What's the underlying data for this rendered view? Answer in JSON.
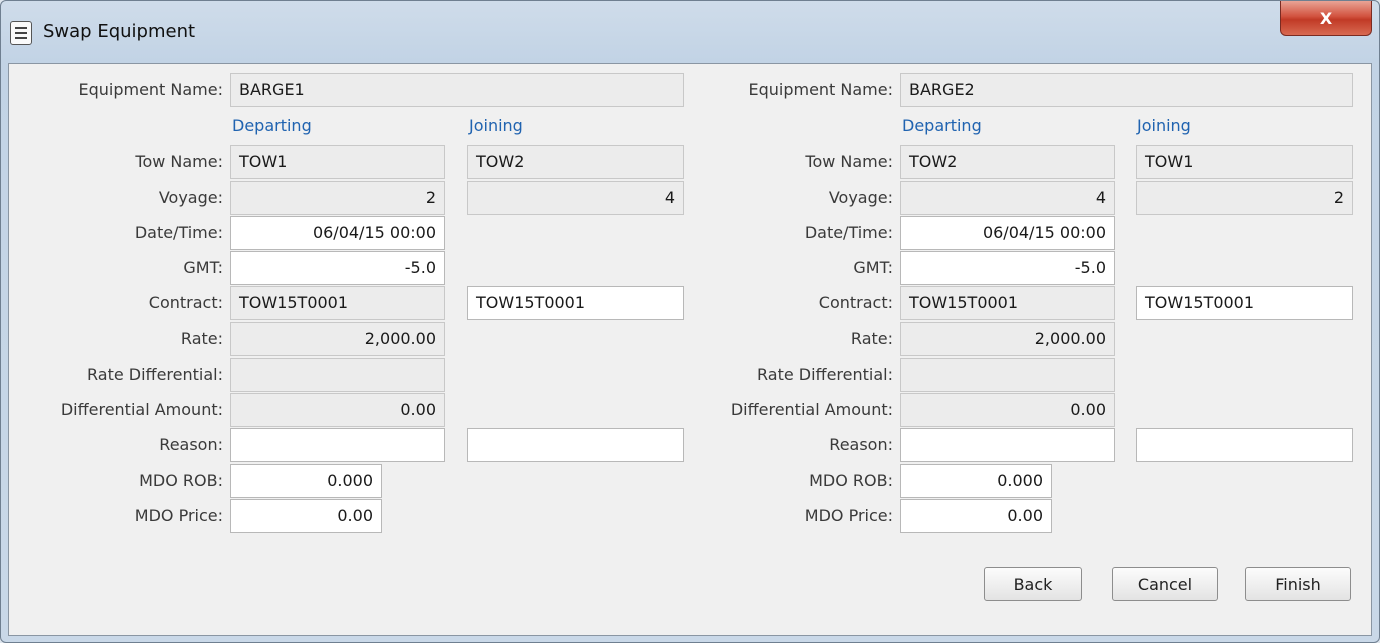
{
  "window": {
    "title": "Swap Equipment",
    "close_label": "X"
  },
  "labels": {
    "equipment_name": "Equipment Name:",
    "departing": "Departing",
    "joining": "Joining",
    "tow_name": "Tow Name:",
    "voyage": "Voyage:",
    "date_time": "Date/Time:",
    "gmt": "GMT:",
    "contract": "Contract:",
    "rate": "Rate:",
    "rate_differential": "Rate Differential:",
    "differential_amount": "Differential Amount:",
    "reason": "Reason:",
    "mdo_rob": "MDO ROB:",
    "mdo_price": "MDO Price:"
  },
  "left": {
    "equipment_name": "BARGE1",
    "departing": {
      "tow_name": "TOW1",
      "voyage": "2",
      "date_time": "06/04/15  00:00",
      "gmt": "-5.0",
      "contract": "TOW15T0001",
      "rate": "2,000.00",
      "rate_differential": "",
      "differential_amount": "0.00",
      "reason": "",
      "mdo_rob": "0.000",
      "mdo_price": "0.00"
    },
    "joining": {
      "tow_name": "TOW2",
      "voyage": "4",
      "contract": "TOW15T0001",
      "reason": ""
    }
  },
  "right": {
    "equipment_name": "BARGE2",
    "departing": {
      "tow_name": "TOW2",
      "voyage": "4",
      "date_time": "06/04/15  00:00",
      "gmt": "-5.0",
      "contract": "TOW15T0001",
      "rate": "2,000.00",
      "rate_differential": "",
      "differential_amount": "0.00",
      "reason": "",
      "mdo_rob": "0.000",
      "mdo_price": "0.00"
    },
    "joining": {
      "tow_name": "TOW1",
      "voyage": "2",
      "contract": "TOW15T0001",
      "reason": ""
    }
  },
  "buttons": {
    "back": "Back",
    "cancel": "Cancel",
    "finish": "Finish"
  }
}
